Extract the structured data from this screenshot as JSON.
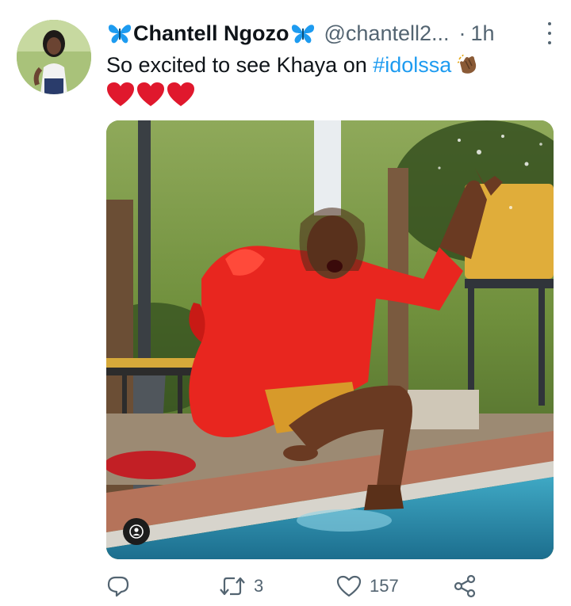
{
  "tweet": {
    "display_name": "Chantell Ngozo",
    "handle": "@chantell2...",
    "separator": "·",
    "time": "1h",
    "text_prefix": "So excited to see Khaya on ",
    "hashtag": "#idolssa",
    "emoji_after_hashtag": "👏🏾",
    "hearts_emoji": "❤️❤️❤️"
  },
  "actions": {
    "reply_count": "",
    "retweet_count": "3",
    "like_count": "157"
  },
  "icons": {
    "name_decoration": "butterfly-icon",
    "more": "more-vertical-icon",
    "reply": "reply-icon",
    "retweet": "retweet-icon",
    "like": "heart-icon",
    "share": "share-icon",
    "media_badge": "person-icon"
  },
  "colors": {
    "link": "#1d9bf0",
    "secondary_text": "#536471",
    "butterfly": "#1d9bf0",
    "heart": "#e0245e"
  }
}
